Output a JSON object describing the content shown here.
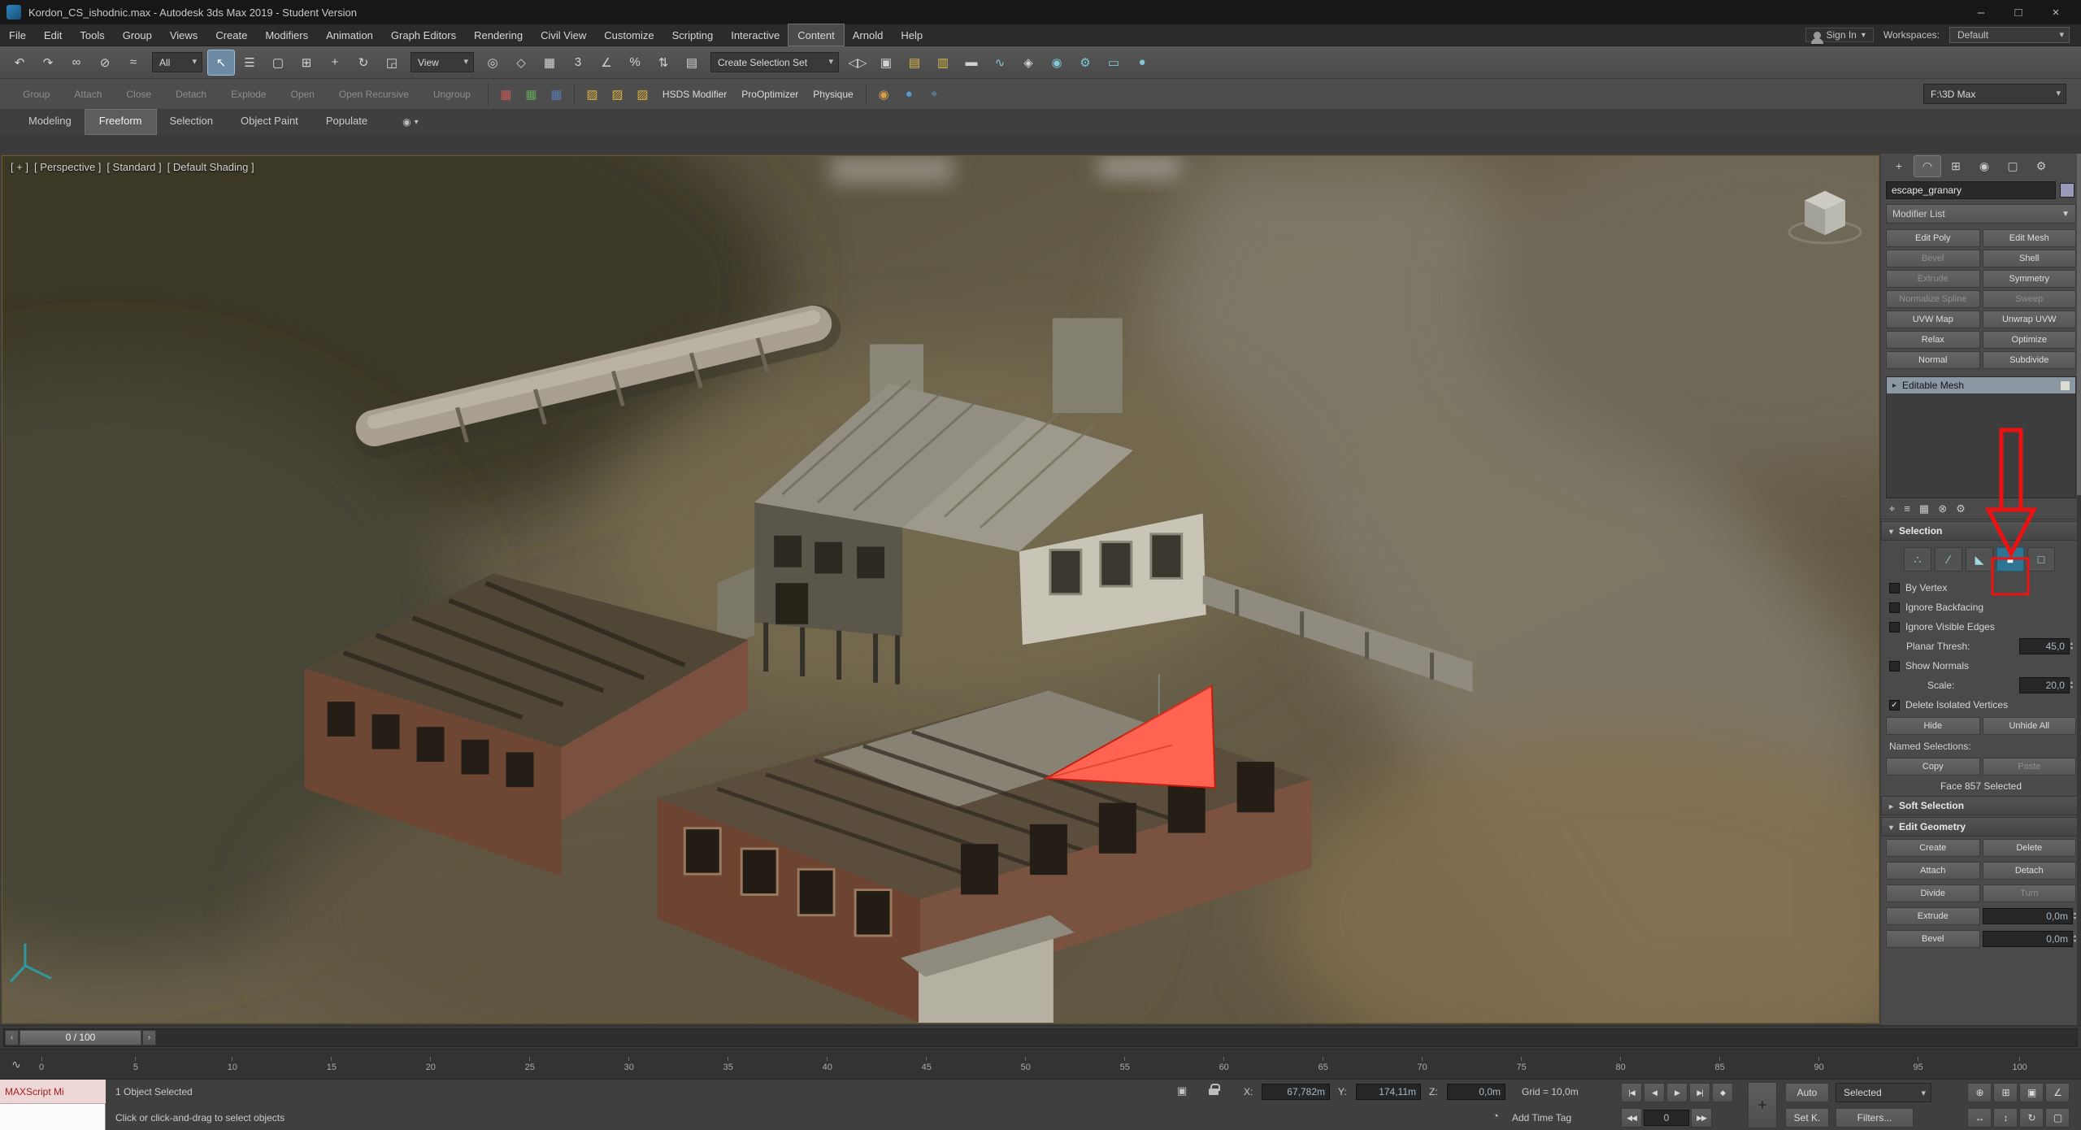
{
  "colors": {
    "accent_blue": "#2e7593",
    "annotation_red": "#ee1111",
    "selected_face": "#ff6352",
    "stack_selected": "#8b97a3"
  },
  "window": {
    "title": "Kordon_CS_ishodnic.max - Autodesk 3ds Max 2019 - Student Version",
    "minimize": "–",
    "maximize": "□",
    "close": "×"
  },
  "menu": {
    "items": [
      {
        "label": "File"
      },
      {
        "label": "Edit"
      },
      {
        "label": "Tools"
      },
      {
        "label": "Group"
      },
      {
        "label": "Views"
      },
      {
        "label": "Create"
      },
      {
        "label": "Modifiers"
      },
      {
        "label": "Animation"
      },
      {
        "label": "Graph Editors"
      },
      {
        "label": "Rendering"
      },
      {
        "label": "Civil View"
      },
      {
        "label": "Customize"
      },
      {
        "label": "Scripting"
      },
      {
        "label": "Interactive"
      },
      {
        "label": "Content",
        "active": true
      },
      {
        "label": "Arnold"
      },
      {
        "label": "Help"
      }
    ],
    "sign_in": "Sign In",
    "workspaces_label": "Workspaces:",
    "workspace_value": "Default"
  },
  "toolbar": {
    "icons_a": [
      {
        "name": "undo-icon",
        "glyph": "↶"
      },
      {
        "name": "redo-icon",
        "glyph": "↷"
      },
      {
        "name": "select-and-link-icon",
        "glyph": "∞"
      },
      {
        "name": "unlink-selection-icon",
        "glyph": "⊘"
      },
      {
        "name": "bind-to-space-warp-icon",
        "glyph": "≈"
      }
    ],
    "selection_filter": "All",
    "icons_b": [
      {
        "name": "select-object-icon",
        "glyph": "↖",
        "active": true
      },
      {
        "name": "select-by-name-icon",
        "glyph": "☰"
      },
      {
        "name": "rectangular-selection-region-icon",
        "glyph": "▢"
      },
      {
        "name": "window-crossing-icon",
        "glyph": "⊞"
      },
      {
        "name": "select-and-move-icon",
        "glyph": "+"
      },
      {
        "name": "select-and-rotate-icon",
        "glyph": "↻"
      },
      {
        "name": "select-and-scale-icon",
        "glyph": "◲"
      }
    ],
    "ref_coord": "View",
    "icons_c": [
      {
        "name": "use-pivot-center-icon",
        "glyph": "◎"
      },
      {
        "name": "select-and-manipulate-icon",
        "glyph": "◇"
      },
      {
        "name": "keyboard-shortcut-override-icon",
        "glyph": "▦"
      },
      {
        "name": "snaps-toggle-icon",
        "glyph": "3"
      },
      {
        "name": "angle-snap-icon",
        "glyph": "∠"
      },
      {
        "name": "percent-snap-icon",
        "glyph": "%"
      },
      {
        "name": "spinner-snap-icon",
        "glyph": "⇅"
      },
      {
        "name": "named-selection-sets-icon",
        "glyph": "▤"
      }
    ],
    "selection_set": "Create Selection Set",
    "icons_d": [
      {
        "name": "mirror-icon",
        "glyph": "◁▷"
      },
      {
        "name": "align-icon",
        "glyph": "▣"
      },
      {
        "name": "scene-explorer-icon",
        "glyph": "▤",
        "tint": "#d8b84a"
      },
      {
        "name": "layer-explorer-icon",
        "glyph": "▥",
        "tint": "#d8b84a"
      },
      {
        "name": "ribbon-toggle-icon",
        "glyph": "▬"
      },
      {
        "name": "curve-editor-icon",
        "glyph": "∿",
        "tint": "#7ec8d8"
      },
      {
        "name": "schematic-view-icon",
        "glyph": "◈"
      },
      {
        "name": "material-editor-icon",
        "glyph": "◉",
        "tint": "#7ec8d8"
      },
      {
        "name": "render-setup-icon",
        "glyph": "⚙",
        "tint": "#7ec8d8"
      },
      {
        "name": "rendered-frame-icon",
        "glyph": "▭",
        "tint": "#7ec8d8"
      },
      {
        "name": "render-production-icon",
        "glyph": "●",
        "tint": "#7ec8d8"
      }
    ]
  },
  "toolbar2": {
    "buttons": [
      {
        "name": "group-button",
        "label": "Group",
        "enabled": false
      },
      {
        "name": "attach-button",
        "label": "Attach",
        "enabled": false
      },
      {
        "name": "close-button",
        "label": "Close",
        "enabled": false
      },
      {
        "name": "detach-button",
        "label": "Detach",
        "enabled": false
      },
      {
        "name": "explode-button",
        "label": "Explode",
        "enabled": false
      },
      {
        "name": "open-button",
        "label": "Open",
        "enabled": false
      },
      {
        "name": "open-recursive-button",
        "label": "Open Recursive",
        "enabled": false
      },
      {
        "name": "ungroup-button",
        "label": "Ungroup",
        "enabled": false
      }
    ],
    "icons_a": [
      {
        "name": "modifier-icon-1",
        "glyph": "▦",
        "tint": "#c05a50"
      },
      {
        "name": "modifier-icon-2",
        "glyph": "▦",
        "tint": "#62a05a"
      },
      {
        "name": "modifier-icon-3",
        "glyph": "▦",
        "tint": "#5a78b0"
      }
    ],
    "icons_b": [
      {
        "name": "modifier-icon-4",
        "glyph": "▨",
        "tint": "#d8b23a"
      },
      {
        "name": "modifier-icon-5",
        "glyph": "▨",
        "tint": "#d8b23a"
      },
      {
        "name": "modifier-icon-6",
        "glyph": "▨",
        "tint": "#d8b23a"
      }
    ],
    "text_buttons": [
      {
        "name": "hsds-modifier-button",
        "label": "HSDS Modifier"
      },
      {
        "name": "prooptimizer-button",
        "label": "ProOptimizer"
      },
      {
        "name": "physique-button",
        "label": "Physique"
      }
    ],
    "icons_c": [
      {
        "name": "character-icon",
        "glyph": "◉",
        "tint": "#d8a04a"
      },
      {
        "name": "world-icon",
        "glyph": "●",
        "tint": "#5a9ad0"
      },
      {
        "name": "bone-tools-icon",
        "glyph": "⌖",
        "tint": "#5a9ad0"
      }
    ],
    "path_value": "F:\\3D Max"
  },
  "ribbon": {
    "tabs": [
      {
        "label": "Modeling"
      },
      {
        "label": "Freeform",
        "active": true
      },
      {
        "label": "Selection"
      },
      {
        "label": "Object Paint"
      },
      {
        "label": "Populate"
      }
    ],
    "options_glyph": "◉"
  },
  "viewport": {
    "plus": "[ + ]",
    "view": "[ Perspective ]",
    "style": "[ Standard ]",
    "shading": "[ Default Shading ]"
  },
  "command_panel": {
    "tabs": [
      {
        "name": "create-tab-icon",
        "glyph": "+"
      },
      {
        "name": "modify-tab-icon",
        "glyph": "◠",
        "active": true
      },
      {
        "name": "hierarchy-tab-icon",
        "glyph": "⊞"
      },
      {
        "name": "motion-tab-icon",
        "glyph": "◉"
      },
      {
        "name": "display-tab-icon",
        "glyph": "▢"
      },
      {
        "name": "utilities-tab-icon",
        "glyph": "⚙"
      }
    ],
    "object_name": "escape_granary",
    "modifier_list_label": "Modifier List",
    "modifier_buttons": [
      {
        "name": "edit-poly-button",
        "label": "Edit Poly"
      },
      {
        "name": "edit-mesh-button",
        "label": "Edit Mesh"
      },
      {
        "name": "bevel-modifier-button",
        "label": "Bevel",
        "enabled": false
      },
      {
        "name": "shell-button",
        "label": "Shell"
      },
      {
        "name": "extrude-modifier-button",
        "label": "Extrude",
        "enabled": false
      },
      {
        "name": "symmetry-button",
        "label": "Symmetry"
      },
      {
        "name": "normalize-spline-button",
        "label": "Normalize Spline",
        "enabled": false
      },
      {
        "name": "sweep-button",
        "label": "Sweep",
        "enabled": false
      },
      {
        "name": "uvw-map-button",
        "label": "UVW Map"
      },
      {
        "name": "unwrap-uvw-button",
        "label": "Unwrap UVW"
      },
      {
        "name": "relax-button",
        "label": "Relax"
      },
      {
        "name": "optimize-button",
        "label": "Optimize"
      },
      {
        "name": "normal-button",
        "label": "Normal"
      },
      {
        "name": "subdivide-button",
        "label": "Subdivide"
      }
    ],
    "stack_item": "Editable Mesh",
    "stack_tools": [
      {
        "name": "pin-stack-icon",
        "glyph": "⌖"
      },
      {
        "name": "show-end-result-icon",
        "glyph": "≡"
      },
      {
        "name": "make-unique-icon",
        "glyph": "▦"
      },
      {
        "name": "remove-modifier-icon",
        "glyph": "⊗"
      },
      {
        "name": "configure-modifier-sets-icon",
        "glyph": "⚙"
      }
    ],
    "subobject_buttons": [
      {
        "name": "vertex-subobject-button",
        "glyph": "∴"
      },
      {
        "name": "edge-subobject-button",
        "glyph": "∕"
      },
      {
        "name": "face-subobject-button",
        "glyph": "◣"
      },
      {
        "name": "polygon-subobject-button",
        "glyph": "■",
        "active": true
      },
      {
        "name": "element-subobject-button",
        "glyph": "□"
      }
    ],
    "selection": {
      "title": "Selection",
      "by_vertex": "By Vertex",
      "ignore_backfacing": "Ignore Backfacing",
      "ignore_visible_edges": "Ignore Visible Edges",
      "planar_label": "Planar Thresh:",
      "planar_value": "45,0",
      "show_normals": "Show Normals",
      "scale_label": "Scale:",
      "scale_value": "20,0",
      "delete_isolated": "Delete Isolated Vertices",
      "delete_isolated_checked": true,
      "hide": "Hide",
      "unhide_all": "Unhide All",
      "named_selections": "Named Selections:",
      "copy": "Copy",
      "paste": "Paste",
      "status": "Face 857 Selected"
    },
    "soft_selection_title": "Soft Selection",
    "edit_geometry": {
      "title": "Edit Geometry",
      "create": "Create",
      "delete": "Delete",
      "attach": "Attach",
      "detach": "Detach",
      "divide": "Divide",
      "turn": "Turn",
      "extrude": "Extrude",
      "extrude_value": "0,0m",
      "bevel": "Bevel",
      "bevel_value": "0,0m"
    }
  },
  "timeline": {
    "prev": "‹",
    "next": "›",
    "slider_label": "0 / 100",
    "curve_glyph": "∿",
    "ticks": [
      "0",
      "5",
      "10",
      "15",
      "20",
      "25",
      "30",
      "35",
      "40",
      "45",
      "50",
      "55",
      "60",
      "65",
      "70",
      "75",
      "80",
      "85",
      "90",
      "95",
      "100"
    ]
  },
  "status_bar": {
    "maxscript": "MAXScript Mi",
    "selection_status": "1 Object Selected",
    "prompt": "Click or click-and-drag to select objects",
    "isolate_glyph": "▣",
    "x_label": "X:",
    "x_value": "67,782m",
    "y_label": "Y:",
    "y_value": "174,11m",
    "z_label": "Z:",
    "z_value": "0,0m",
    "grid_label": "Grid = 10,0m",
    "clock_glyph": "◔",
    "add_time_tag": "Add Time Tag",
    "transport_row1": [
      {
        "name": "go-to-start-button",
        "glyph": "|◀"
      },
      {
        "name": "previous-frame-button",
        "glyph": "◀"
      },
      {
        "name": "play-button",
        "glyph": "▶"
      },
      {
        "name": "go-to-end-button",
        "glyph": "▶|"
      },
      {
        "name": "key-mode-toggle-button",
        "glyph": "◆"
      }
    ],
    "prev_key_glyph": "◀◀",
    "next_key_glyph": "▶▶",
    "frame_value": "0",
    "set_keys_glyph": "+",
    "auto": "Auto",
    "selected": "Selected",
    "set_key_abbrev": "Set K.",
    "filters": "Filters...",
    "nav_row1": [
      {
        "name": "zoom-icon",
        "glyph": "⊕"
      },
      {
        "name": "zoom-all-icon",
        "glyph": "⊞"
      },
      {
        "name": "zoom-extents-icon",
        "glyph": "▣"
      },
      {
        "name": "field-of-view-icon",
        "glyph": "∠"
      }
    ],
    "nav_row2": [
      {
        "name": "pan-view-icon",
        "glyph": "↔"
      },
      {
        "name": "walk-through-icon",
        "glyph": "↕"
      },
      {
        "name": "orbit-icon",
        "glyph": "↻"
      },
      {
        "name": "maximize-viewport-icon",
        "glyph": "▢"
      }
    ]
  }
}
